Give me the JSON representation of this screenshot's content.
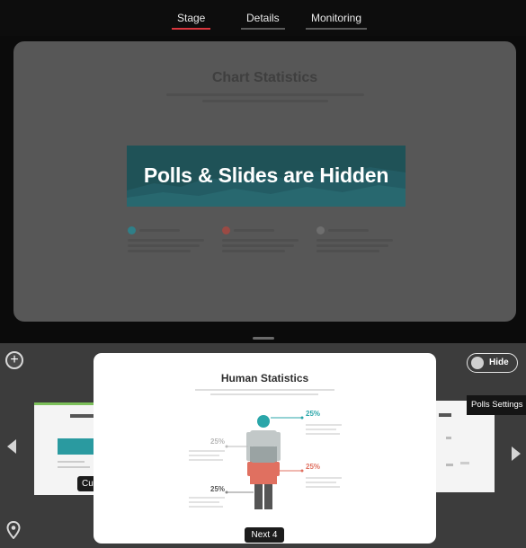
{
  "tabs": [
    {
      "label": "Stage",
      "active": true
    },
    {
      "label": "Details",
      "active": false
    },
    {
      "label": "Monitoring",
      "active": false
    }
  ],
  "stage": {
    "slide_title": "Chart Statistics",
    "overlay_text": "Polls & Slides are Hidden"
  },
  "carousel": {
    "add_icon": "plus-circle-icon",
    "left_card_label": "Cu",
    "main_card": {
      "title": "Human Statistics",
      "percentages": [
        "25%",
        "25%",
        "25%",
        "25%"
      ],
      "next_label": "Next 4"
    },
    "hide_toggle_label": "Hide",
    "tooltip": "Polls Settings"
  },
  "colors": {
    "accent_red": "#d9363e",
    "teal": "#2aa6a9",
    "salmon": "#e07060",
    "banner": "#1f5257"
  }
}
